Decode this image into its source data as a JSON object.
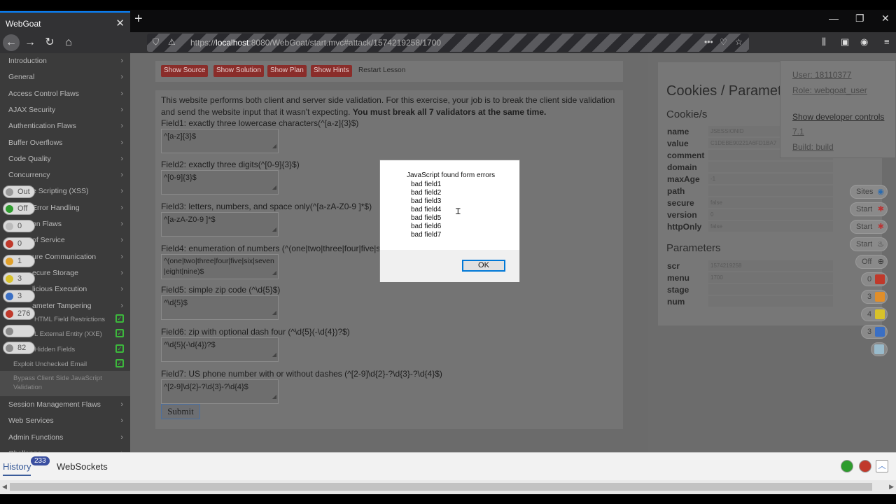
{
  "browser": {
    "tab_title": "WebGoat",
    "url_prefix": "https://",
    "url_host": "localhost",
    "url_rest": ":8080/WebGoat/start.mvc#attack/1574219258/1700"
  },
  "sidebar": {
    "items": [
      {
        "label": "Introduction"
      },
      {
        "label": "General"
      },
      {
        "label": "Access Control Flaws"
      },
      {
        "label": "AJAX Security"
      },
      {
        "label": "Authentication Flaws"
      },
      {
        "label": "Buffer Overflows"
      },
      {
        "label": "Code Quality"
      },
      {
        "label": "Concurrency"
      },
      {
        "label": "e Scripting (XSS)"
      },
      {
        "label": "Error Handling"
      },
      {
        "label": "on Flaws"
      },
      {
        "label": "of Service"
      },
      {
        "label": "ure Communication"
      },
      {
        "label": "ecure Storage"
      },
      {
        "label": "licious Execution"
      },
      {
        "label": "ameter Tampering"
      }
    ],
    "subitems": [
      {
        "label": "HTML Field Restrictions"
      },
      {
        "label": "L External Entity (XXE)"
      },
      {
        "label": "Hidden Fields"
      },
      {
        "label": "Exploit Unchecked Email"
      }
    ],
    "active_item": "Bypass Client Side JavaScript Validation",
    "bottom_items": [
      {
        "label": "Session Management Flaws"
      },
      {
        "label": "Web Services"
      },
      {
        "label": "Admin Functions"
      },
      {
        "label": "Challenge"
      }
    ]
  },
  "badges": [
    "Out",
    "Off",
    "0",
    "0",
    "1",
    "3",
    "3",
    "276",
    "",
    "82"
  ],
  "lesson": {
    "buttons": [
      "Show Source",
      "Show Solution",
      "Show Plan",
      "Show Hints",
      "Restart Lesson"
    ],
    "intro": "This website performs both client and server side validation. For this exercise, your job is to break the client side validation and send the website input that it wasn't expecting.",
    "intro_bold": "You must break all 7 validators at the same time.",
    "fields": [
      {
        "label": "Field1: exactly three lowercase characters(^[a-z]{3}$)",
        "value": "^[a-z]{3}$"
      },
      {
        "label": "Field2: exactly three digits(^[0-9]{3}$)",
        "value": "^[0-9]{3}$"
      },
      {
        "label": "Field3: letters, numbers, and space only(^[a-zA-Z0-9 ]*$)",
        "value": "^[a-zA-Z0-9 ]*$"
      },
      {
        "label": "Field4: enumeration of numbers (^(one|two|three|four|five|six|seven|eight|nine)$)",
        "value": "^(one|two|three|four|five|six|seven|eight|nine)$"
      },
      {
        "label": "Field5: simple zip code (^\\d{5}$)",
        "value": "^\\d{5}$"
      },
      {
        "label": "Field6: zip with optional dash four (^\\d{5}(-\\d{4})?$)",
        "value": "^\\d{5}(-\\d{4})?$"
      },
      {
        "label": "Field7: US phone number with or without dashes (^[2-9]\\d{2}-?\\d{3}-?\\d{4}$)",
        "value": "^[2-9]\\d{2}-?\\d{3}-?\\d{4}$"
      }
    ],
    "submit": "Submit"
  },
  "cookies": {
    "title": "Cookies / Parameters",
    "cookie_heading": "Cookie/s",
    "cookie_rows": [
      {
        "key": "name",
        "value": "JSESSIONID"
      },
      {
        "key": "value",
        "value": "C1DEBE90221A6FD1BA7"
      },
      {
        "key": "comment",
        "value": ""
      },
      {
        "key": "domain",
        "value": ""
      },
      {
        "key": "maxAge",
        "value": "-1"
      },
      {
        "key": "path",
        "value": ""
      },
      {
        "key": "secure",
        "value": "false"
      },
      {
        "key": "version",
        "value": "0"
      },
      {
        "key": "httpOnly",
        "value": "false"
      }
    ],
    "params_heading": "Parameters",
    "param_rows": [
      {
        "key": "scr",
        "value": "1574219258"
      },
      {
        "key": "menu",
        "value": "1700"
      },
      {
        "key": "stage",
        "value": ""
      },
      {
        "key": "num",
        "value": ""
      }
    ]
  },
  "user_menu": {
    "user": "User: 18110377",
    "role": "Role: webgoat_user",
    "dev": "Show developer controls",
    "version": "7.1",
    "build": "Build: build"
  },
  "right_controls": [
    "Sites",
    "Start",
    "Start",
    "Start",
    "Off",
    "0",
    "3",
    "4",
    "3"
  ],
  "dialog": {
    "title": "JavaScript found form errors",
    "lines": [
      "bad field1",
      "bad field2",
      "bad field3",
      "bad field4",
      "bad field5",
      "bad field6",
      "bad field7"
    ],
    "ok": "OK"
  },
  "devtools": {
    "history": "History",
    "history_count": "233",
    "websockets": "WebSockets"
  }
}
